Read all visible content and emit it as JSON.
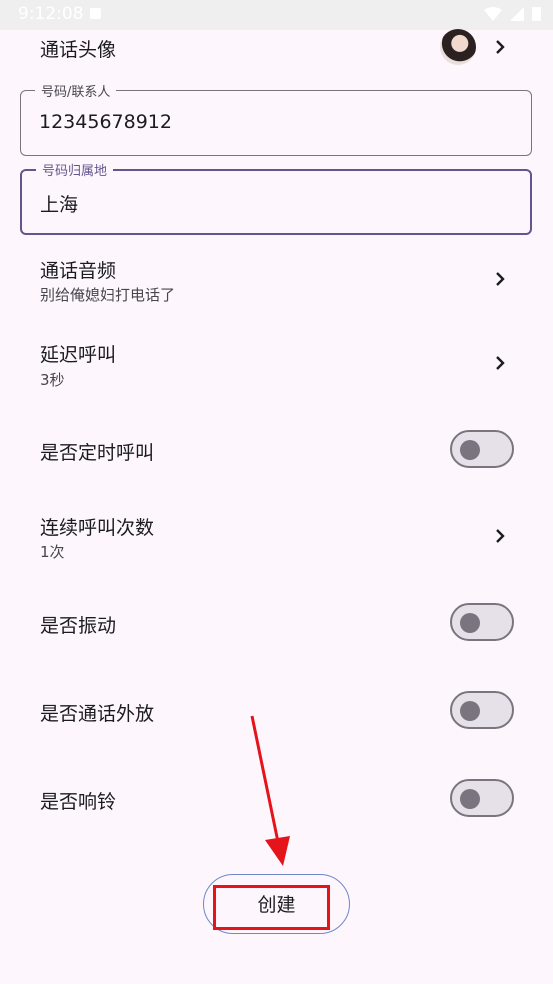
{
  "status_bar": {
    "time": "9:12:08"
  },
  "avatar_row": {
    "label": "通话头像"
  },
  "phone_field": {
    "label": "号码/联系人",
    "value": "12345678912"
  },
  "location_field": {
    "label": "号码归属地",
    "value": "上海"
  },
  "audio_row": {
    "title": "通话音频",
    "subtitle": "别给俺媳妇打电话了"
  },
  "delay_row": {
    "title": "延迟呼叫",
    "subtitle": "3秒"
  },
  "timed_row": {
    "title": "是否定时呼叫",
    "enabled": false
  },
  "repeat_row": {
    "title": "连续呼叫次数",
    "subtitle": "1次"
  },
  "vibrate_row": {
    "title": "是否振动",
    "enabled": false
  },
  "speaker_row": {
    "title": "是否通话外放",
    "enabled": false
  },
  "ring_row": {
    "title": "是否响铃",
    "enabled": false
  },
  "create_button": {
    "label": "创建"
  },
  "colors": {
    "accent": "#65558f",
    "background": "#fdf7fd",
    "highlight": "#e5131a"
  }
}
